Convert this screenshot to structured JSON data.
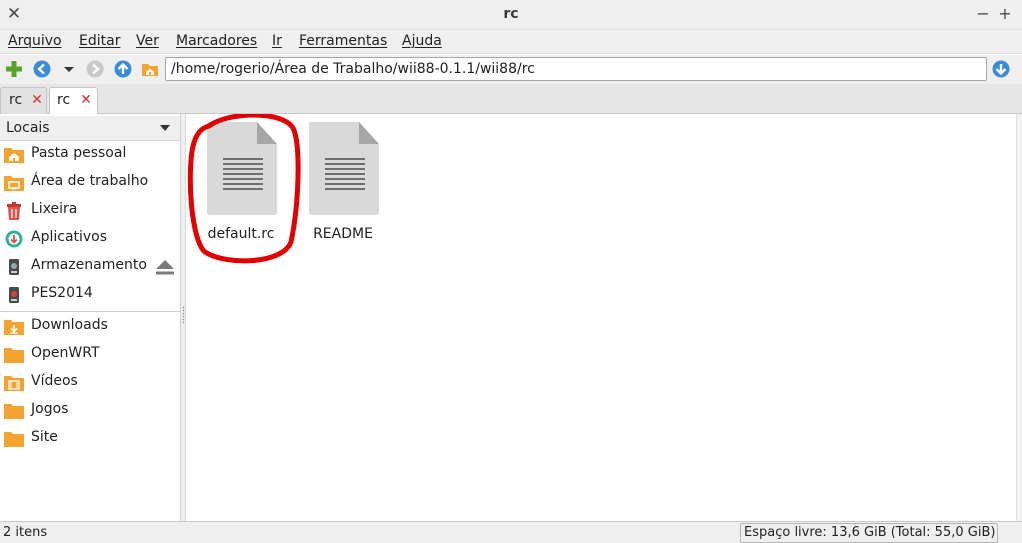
{
  "window": {
    "title": "rc",
    "close_glyph": "✕",
    "minimize_glyph": "−",
    "maximize_glyph": "+"
  },
  "menu": {
    "items": [
      "Arquivo",
      "Editar",
      "Ver",
      "Marcadores",
      "Ir",
      "Ferramentas",
      "Ajuda"
    ]
  },
  "toolbar": {
    "path": "/home/rogerio/Área de Trabalho/wii88-0.1.1/wii88/rc",
    "icons": [
      "new-tab-plus-icon",
      "back-icon",
      "history-dropdown-icon",
      "forward-icon",
      "up-icon",
      "home-icon",
      "go-icon"
    ]
  },
  "tabs": [
    {
      "label": "rc",
      "close_glyph": "✕"
    },
    {
      "label": "rc",
      "close_glyph": "✕"
    }
  ],
  "sidebar": {
    "header": "Locais",
    "places": [
      {
        "label": "Pasta pessoal",
        "icon": "home-folder-icon"
      },
      {
        "label": "Área de trabalho",
        "icon": "desktop-folder-icon"
      },
      {
        "label": "Lixeira",
        "icon": "trash-icon"
      },
      {
        "label": "Aplicativos",
        "icon": "applications-icon"
      },
      {
        "label": "Armazenamento",
        "icon": "drive-icon",
        "eject_icon": "eject-icon"
      },
      {
        "label": "PES2014",
        "icon": "drive-icon"
      }
    ],
    "bookmarks": [
      {
        "label": "Downloads",
        "icon": "downloads-folder-icon"
      },
      {
        "label": "OpenWRT",
        "icon": "folder-icon"
      },
      {
        "label": "Vídeos",
        "icon": "videos-folder-icon"
      },
      {
        "label": "Jogos",
        "icon": "folder-icon"
      },
      {
        "label": "Site",
        "icon": "folder-icon"
      }
    ]
  },
  "files": [
    {
      "name": "default.rc",
      "icon": "text-document-icon",
      "annotated": true
    },
    {
      "name": "README",
      "icon": "text-document-icon",
      "annotated": false
    }
  ],
  "colors": {
    "annotation": "#e00000",
    "folder": "#f3a330",
    "accent_blue": "#3b8bd8",
    "tab_close": "#d03030"
  },
  "status": {
    "item_count": "2 itens",
    "free_space": "Espaço livre: 13,6 GiB (Total: 55,0 GiB)"
  }
}
